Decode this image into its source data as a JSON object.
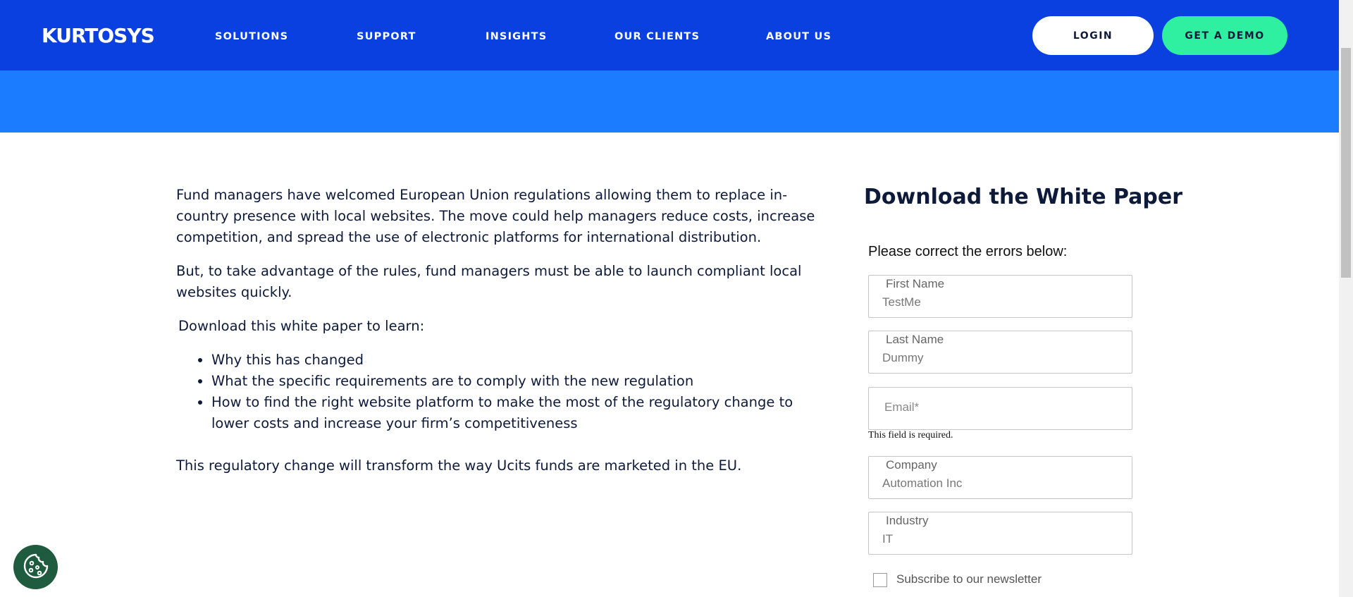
{
  "header": {
    "logo": "KURTOSYS",
    "nav": [
      "SOLUTIONS",
      "SUPPORT",
      "INSIGHTS",
      "OUR CLIENTS",
      "ABOUT US"
    ],
    "login_label": "LOGIN",
    "demo_label": "GET A DEMO",
    "colors": {
      "header_bg": "#0a3fe0",
      "band_bg": "#1b7cff",
      "demo_bg": "#2ef0a0"
    }
  },
  "content": {
    "p1": "Fund managers have welcomed European Union regulations allowing them to replace in-country presence with local websites. The move could help managers reduce costs, increase competition, and spread the use of electronic platforms for international distribution.",
    "p2": "But, to take advantage of the rules, fund managers must be able to launch compliant local websites quickly.",
    "intro": "Download this white paper to learn:",
    "bullets": [
      "Why this has changed",
      "What the specific requirements are to comply with the new regulation",
      "How to find the right website platform to make the most of the regulatory change to lower costs and increase your firm’s competitiveness"
    ],
    "closing": "This regulatory change will transform the way Ucits funds are marketed in the EU."
  },
  "form": {
    "title": "Download the White Paper",
    "error_head": "Please correct the errors below:",
    "first_name": {
      "label": "First Name",
      "value": "TestMe"
    },
    "last_name": {
      "label": "Last Name",
      "value": "Dummy"
    },
    "email": {
      "placeholder": "Email*",
      "error": "This field is required."
    },
    "company": {
      "label": "Company",
      "value": "Automation Inc"
    },
    "industry": {
      "label": "Industry",
      "value": "IT"
    },
    "newsletter_label": "Subscribe to our newsletter"
  },
  "cookie": {
    "icon": "cookie-icon"
  }
}
